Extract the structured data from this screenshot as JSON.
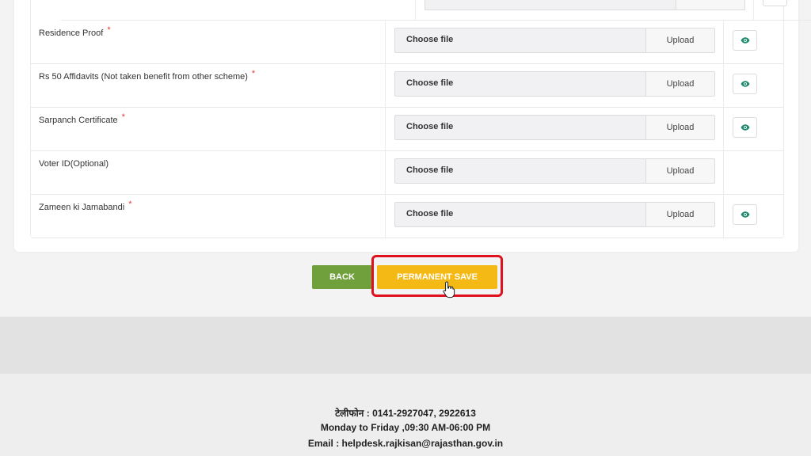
{
  "documents": [
    {
      "label": "Residence Proof",
      "required": true,
      "has_preview": true
    },
    {
      "label": "Rs 50 Affidavits (Not taken benefit from other scheme)",
      "required": true,
      "has_preview": true
    },
    {
      "label": "Sarpanch Certificate",
      "required": true,
      "has_preview": true
    },
    {
      "label": "Voter ID(Optional)",
      "required": false,
      "has_preview": false
    },
    {
      "label": "Zameen ki Jamabandi",
      "required": true,
      "has_preview": true
    }
  ],
  "file_input": {
    "choose_label": "Choose file",
    "upload_label": "Upload"
  },
  "required_marker": "*",
  "icons": {
    "preview": "eye-icon",
    "cursor": "hand-pointer-icon"
  },
  "actions": {
    "back_label": "BACK",
    "save_label": "PERMANENT SAVE"
  },
  "colors": {
    "back": "#6fa03c",
    "save": "#f5b915",
    "highlight": "#e0101e",
    "eye": "#1e8a6e",
    "required": "#e53935"
  },
  "footer": {
    "phone": "टेलीफोन : 0141-2927047, 2922613",
    "hours": "Monday to Friday ,09:30 AM-06:00 PM",
    "email": "Email : helpdesk.rajkisan@rajasthan.gov.in"
  }
}
